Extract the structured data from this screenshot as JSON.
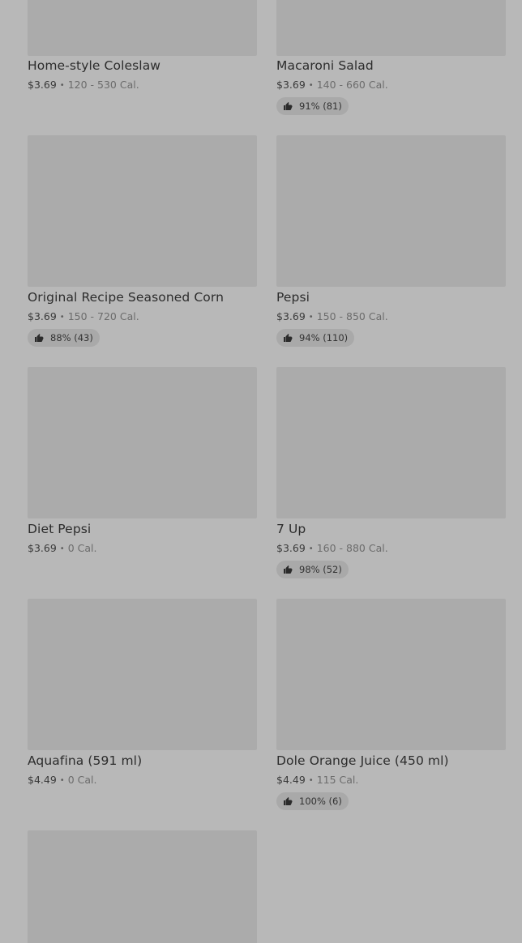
{
  "items": [
    {
      "name": "Home-style Coleslaw",
      "price": "$3.69",
      "calories": "120 - 530 Cal.",
      "rating": null
    },
    {
      "name": "Macaroni Salad",
      "price": "$3.69",
      "calories": "140 - 660 Cal.",
      "rating": "91% (81)"
    },
    {
      "name": "Original Recipe Seasoned Corn",
      "price": "$3.69",
      "calories": "150 - 720 Cal.",
      "rating": "88% (43)"
    },
    {
      "name": "Pepsi",
      "price": "$3.69",
      "calories": "150 - 850 Cal.",
      "rating": "94% (110)"
    },
    {
      "name": "Diet Pepsi",
      "price": "$3.69",
      "calories": "0 Cal.",
      "rating": null
    },
    {
      "name": "7 Up",
      "price": "$3.69",
      "calories": "160 - 880 Cal.",
      "rating": "98% (52)"
    },
    {
      "name": "Aquafina (591 ml)",
      "price": "$4.49",
      "calories": "0 Cal.",
      "rating": null
    },
    {
      "name": "Dole Orange Juice (450 ml)",
      "price": "$4.49",
      "calories": "115 Cal.",
      "rating": "100% (6)"
    },
    {
      "name": "",
      "price": "",
      "calories": "",
      "rating": null
    }
  ],
  "separator": "•",
  "icons": {
    "rating": "thumbs-up-icon"
  },
  "colors": {
    "background": "#b8b8b8",
    "thumbnail": "#ababab",
    "badge": "#a9a9a9"
  }
}
